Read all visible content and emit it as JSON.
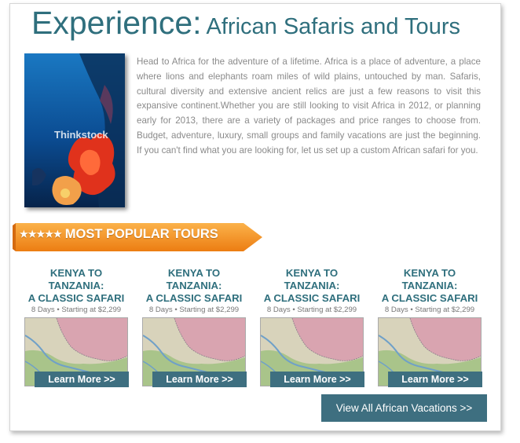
{
  "page": {
    "title_main": "Experience:",
    "title_sub": "African Safaris and Tours"
  },
  "intro": {
    "paragraph": "Head to Africa for the adventure of a lifetime. Africa is a place of adventure, a place where lions and elephants roam miles of wild plains, untouched by man. Safaris, cultural diversity and extensive ancient relics are just a few reasons to visit this expansive continent.Whether you are still looking to visit Africa in 2012, or planning early for 2013, there are a variety of packages and price ranges to choose from. Budget, adventure, luxury, small groups and family vacations are just the beginning. If you can't find what you are looking for, let us set up a custom African safari for you.",
    "photo_watermark": "Thinkstock"
  },
  "banner": {
    "stars": "★★★★★",
    "label": "MOST POPULAR TOURS"
  },
  "tours": [
    {
      "title_line1": "KENYA TO TANZANIA:",
      "title_line2": "A CLASSIC SAFARI",
      "meta": "8 Days • Starting at $2,299",
      "button": "Learn More >>"
    },
    {
      "title_line1": "KENYA TO TANZANIA:",
      "title_line2": "A CLASSIC SAFARI",
      "meta": "8 Days • Starting at $2,299",
      "button": "Learn More >>"
    },
    {
      "title_line1": "KENYA TO TANZANIA:",
      "title_line2": "A CLASSIC SAFARI",
      "meta": "8 Days • Starting at $2,299",
      "button": "Learn More >>"
    },
    {
      "title_line1": "KENYA TO TANZANIA:",
      "title_line2": "A CLASSIC SAFARI",
      "meta": "8 Days • Starting at $2,299",
      "button": "Learn More >>"
    }
  ],
  "footer": {
    "view_all": "View All African Vacations >>"
  },
  "colors": {
    "accent": "#2f6f7d",
    "button": "#3e6f80",
    "banner_orange": "#f08a1e"
  }
}
